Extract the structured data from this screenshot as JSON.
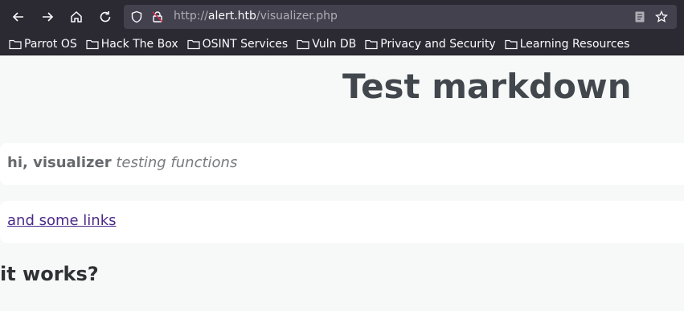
{
  "browser": {
    "url_prefix": "http://",
    "url_host": "alert.htb",
    "url_path": "/visualizer.php",
    "bookmarks": [
      {
        "label": "Parrot OS"
      },
      {
        "label": "Hack The Box"
      },
      {
        "label": "OSINT Services"
      },
      {
        "label": "Vuln DB"
      },
      {
        "label": "Privacy and Security"
      },
      {
        "label": "Learning Resources"
      }
    ]
  },
  "content": {
    "title": "Test markdown",
    "bold_text": "hi, visualizer",
    "italic_text": "testing functions",
    "link_text": "and some links",
    "heading2": "it works?"
  }
}
